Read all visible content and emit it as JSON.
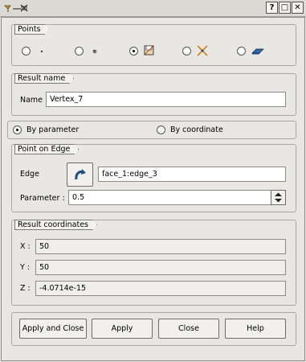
{
  "window": {
    "controls": [
      "?",
      "□",
      "✕"
    ]
  },
  "points": {
    "title": "Points",
    "options": [
      {
        "icon": "point-dot-icon",
        "selected": false
      },
      {
        "icon": "point-on-sphere-icon",
        "selected": false
      },
      {
        "icon": "point-on-edge-icon",
        "selected": true
      },
      {
        "icon": "point-intersection-icon",
        "selected": false
      },
      {
        "icon": "point-on-face-icon",
        "selected": false
      }
    ]
  },
  "result_name": {
    "title": "Result name",
    "label": "Name",
    "value": "Vertex_7"
  },
  "mode": {
    "by_parameter": "By parameter",
    "by_coordinate": "By coordinate",
    "selected": "by_parameter"
  },
  "point_on_edge": {
    "title": "Point on Edge",
    "edge_label": "Edge",
    "edge_value": "face_1:edge_3",
    "param_label": "Parameter :",
    "param_value": "0.5"
  },
  "result_coords": {
    "title": "Result coordinates",
    "x_label": "X :",
    "x_value": "50",
    "y_label": "Y :",
    "y_value": "50",
    "z_label": "Z :",
    "z_value": "-4.0714e-15"
  },
  "buttons": {
    "apply_close": "Apply and Close",
    "apply": "Apply",
    "close": "Close",
    "help": "Help"
  },
  "colors": {
    "window_bg": "#e9e7e3",
    "accent_blue": "#2f6cb5"
  }
}
